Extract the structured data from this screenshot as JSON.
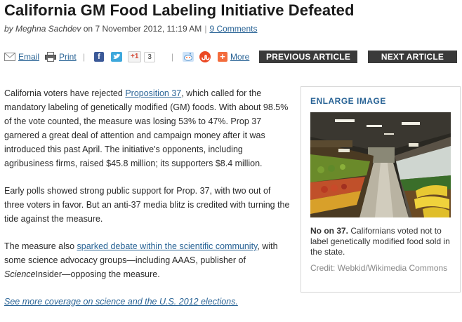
{
  "article": {
    "title": "California GM Food Labeling Initiative Defeated",
    "byline_prefix": "by ",
    "author": "Meghna Sachdev",
    "date": " on 7 November 2012, 11:19 AM",
    "separator": "|",
    "comments_link": "9 Comments"
  },
  "toolbar": {
    "email_label": "Email",
    "print_label": "Print",
    "divider": "|",
    "facebook_glyph": "f",
    "gplus_label": "+1",
    "gplus_count": "3",
    "more_label": "More",
    "previous_label": "PREVIOUS ARTICLE",
    "next_label": "NEXT ARTICLE",
    "icons": [
      "email-icon",
      "print-icon",
      "facebook-icon",
      "twitter-icon",
      "google-plus-icon",
      "reddit-icon",
      "stumbleupon-icon",
      "share-more-icon"
    ],
    "colors": {
      "facebook": "#3b5998",
      "twitter": "#3ea8dc",
      "stumbleupon": "#eb4823",
      "share_more": "#f36c3d",
      "nav_button": "#3a3a3a",
      "link": "#2a6496"
    }
  },
  "body": {
    "p1_before": "California voters have rejected ",
    "p1_link": "Proposition 37",
    "p1_after": ", which called for the mandatory labeling of genetically modified (GM) foods. With about 98.5% of the vote counted, the measure was losing 53% to 47%. Prop 37 garnered a great deal of attention and campaign money after it was introduced this past April. The initiative's opponents, including agribusiness firms, raised $45.8 million; its supporters $8.4 million.",
    "p2": "Early polls showed strong public support for Prop. 37, with two out of three voters in favor. But an anti-37 media blitz is credited with turning the tide against the measure.",
    "p3_before": "The measure also ",
    "p3_link": "sparked debate within the scientific community",
    "p3_mid": ", with some science advocacy groups—including AAAS, publisher of ",
    "p3_em": "Science",
    "p3_after": "Insider—opposing the measure.",
    "more_link": "See more coverage on science and the U.S. 2012 elections."
  },
  "sidebar": {
    "enlarge_label": "ENLARGE IMAGE",
    "photo_alt": "supermarket produce aisle",
    "caption_bold": "No on 37.",
    "caption_text": " Californians voted not to label genetically modified food sold in the state.",
    "credit": "Credit: Webkid/Wikimedia Commons"
  }
}
